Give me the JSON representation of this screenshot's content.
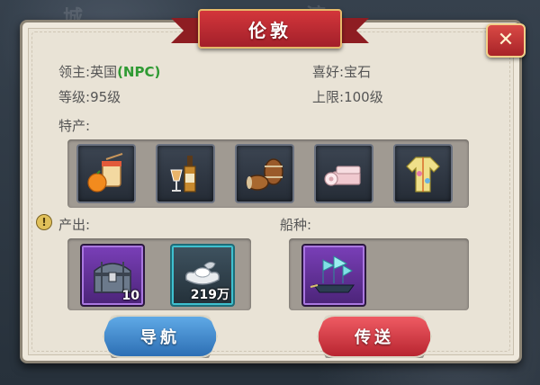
{
  "title": "伦敦",
  "lord": {
    "label": "领主:",
    "value": "英国",
    "tag": "(NPC)"
  },
  "preference": {
    "label": "喜好:",
    "value": "宝石"
  },
  "level": {
    "label": "等级:",
    "value": "95级"
  },
  "limit": {
    "label": "上限:",
    "value": "100级"
  },
  "specialty_label": "特产:",
  "specialties": [
    "noodles-and-orange",
    "wine-bottle-and-glass",
    "barrels",
    "cloth-bolts",
    "embroidered-robe"
  ],
  "output_label": "产出:",
  "outputs": [
    {
      "icon": "treasure-chest",
      "count": "10",
      "rarity_color": "#7a3fb8"
    },
    {
      "icon": "silver-ingot",
      "count": "219万",
      "rarity_color": "#3fc0cf"
    }
  ],
  "ship_label": "船种:",
  "ships": [
    {
      "icon": "sailing-ship",
      "rarity_color": "#7a3fb8"
    }
  ],
  "buttons": {
    "navigate": "导航",
    "teleport": "传送"
  },
  "colors": {
    "accent_red": "#c1272d",
    "npc_green": "#2f9a33",
    "nav_blue": "#2d6fb4"
  }
}
